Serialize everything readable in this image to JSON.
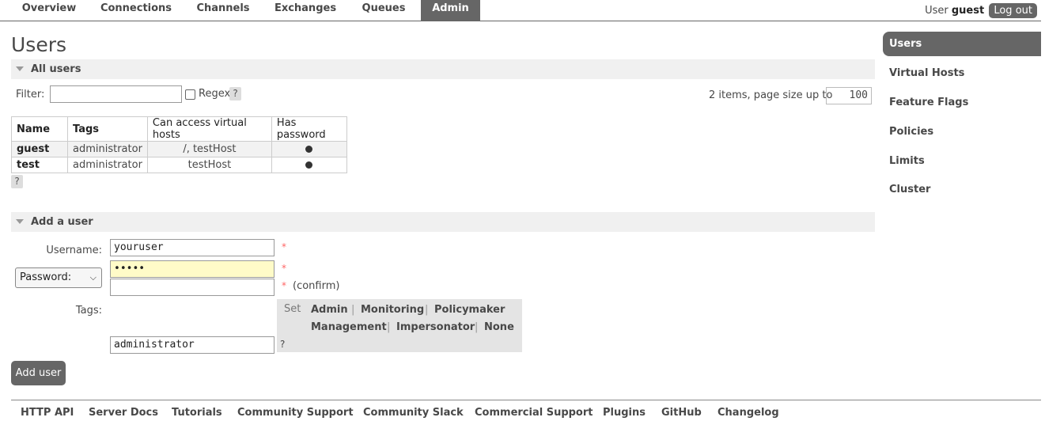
{
  "nav": {
    "tabs": [
      "Overview",
      "Connections",
      "Channels",
      "Exchanges",
      "Queues",
      "Admin"
    ],
    "active": "Admin",
    "user_prefix": "User",
    "username": "guest",
    "logout": "Log out"
  },
  "page": {
    "title": "Users"
  },
  "all_users": {
    "header": "All users",
    "filter_label": "Filter:",
    "filter_value": "",
    "regex_label": "Regex",
    "help": "?",
    "page_info": "2 items, page size up to",
    "page_size": "100",
    "columns": [
      "Name",
      "Tags",
      "Can access virtual hosts",
      "Has password"
    ],
    "rows": [
      {
        "name": "guest",
        "tags": "administrator",
        "vhosts": "/, testHost",
        "has_password": true
      },
      {
        "name": "test",
        "tags": "administrator",
        "vhosts": "testHost",
        "has_password": true
      }
    ]
  },
  "add_user": {
    "header": "Add a user",
    "username_label": "Username:",
    "username_value": "youruser",
    "password_select": "Password:",
    "password_value": "•••••",
    "confirm_value": "",
    "confirm_label": "(confirm)",
    "required": "*",
    "tags_label": "Tags:",
    "tags_value": "administrator",
    "tags_help": "?",
    "set_label": "Set",
    "tag_options": [
      "Admin",
      "Monitoring",
      "Policymaker",
      "Management",
      "Impersonator",
      "None"
    ],
    "separator": "|",
    "submit": "Add user"
  },
  "sidebar": {
    "items": [
      "Users",
      "Virtual Hosts",
      "Feature Flags",
      "Policies",
      "Limits",
      "Cluster"
    ],
    "active": "Users"
  },
  "footer": {
    "links": [
      "HTTP API",
      "Server Docs",
      "Tutorials",
      "Community Support",
      "Community Slack",
      "Commercial Support",
      "Plugins",
      "GitHub",
      "Changelog"
    ]
  }
}
